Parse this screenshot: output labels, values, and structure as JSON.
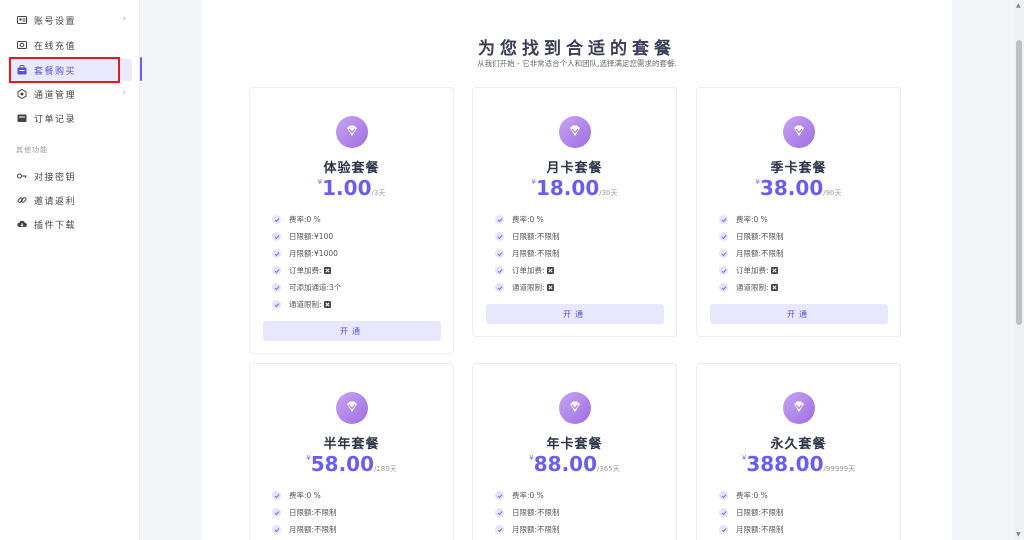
{
  "sidebar": {
    "items": [
      {
        "label": "账号设置",
        "icon": "id-card-icon",
        "has_arrow": true
      },
      {
        "label": "在线充值",
        "icon": "wallet-icon",
        "has_arrow": false
      },
      {
        "label": "套餐购买",
        "icon": "shopping-bag-icon",
        "has_arrow": false,
        "active": true
      },
      {
        "label": "通道管理",
        "icon": "settings-hex-icon",
        "has_arrow": true
      },
      {
        "label": "订单记录",
        "icon": "order-folder-icon",
        "has_arrow": false
      }
    ],
    "section_label": "其他功能",
    "extra_items": [
      {
        "label": "对接密钥",
        "icon": "key-icon"
      },
      {
        "label": "邀请返利",
        "icon": "link-icon"
      },
      {
        "label": "插件下载",
        "icon": "cloud-download-icon"
      }
    ],
    "arrow_glyph": "›"
  },
  "main": {
    "title": "为您找到合适的套餐",
    "subtitle": "从我们开始 - 它非常适合个人和团队,选择满足您需求的套餐."
  },
  "plans": [
    {
      "name": "体验套餐",
      "currency": "¥",
      "price": "1.00",
      "period": "/3天",
      "features": [
        {
          "label": "费率:",
          "value": "0 %"
        },
        {
          "label": "日限额:",
          "value": "¥100"
        },
        {
          "label": "月限额:",
          "value": "¥1000"
        },
        {
          "label": "订单加费:",
          "value": "",
          "x": true
        },
        {
          "label": "可添加通道:",
          "value": "3个"
        },
        {
          "label": "通道限制:",
          "value": "",
          "x": true
        }
      ],
      "button": "开通"
    },
    {
      "name": "月卡套餐",
      "currency": "¥",
      "price": "18.00",
      "period": "/30天",
      "features": [
        {
          "label": "费率:",
          "value": "0 %"
        },
        {
          "label": "日限额:",
          "value": "不限制"
        },
        {
          "label": "月限额:",
          "value": "不限制"
        },
        {
          "label": "订单加费:",
          "value": "",
          "x": true
        },
        {
          "label": "通道限制:",
          "value": "",
          "x": true
        }
      ],
      "button": "开通"
    },
    {
      "name": "季卡套餐",
      "currency": "¥",
      "price": "38.00",
      "period": "/90天",
      "features": [
        {
          "label": "费率:",
          "value": "0 %"
        },
        {
          "label": "日限额:",
          "value": "不限制"
        },
        {
          "label": "月限额:",
          "value": "不限制"
        },
        {
          "label": "订单加费:",
          "value": "",
          "x": true
        },
        {
          "label": "通道限制:",
          "value": "",
          "x": true
        }
      ],
      "button": "开通"
    },
    {
      "name": "半年套餐",
      "currency": "¥",
      "price": "58.00",
      "period": "/180天",
      "features": [
        {
          "label": "费率:",
          "value": "0 %"
        },
        {
          "label": "日限额:",
          "value": "不限制"
        },
        {
          "label": "月限额:",
          "value": "不限制"
        }
      ],
      "button": ""
    },
    {
      "name": "年卡套餐",
      "currency": "¥",
      "price": "88.00",
      "period": "/365天",
      "features": [
        {
          "label": "费率:",
          "value": "0 %"
        },
        {
          "label": "日限额:",
          "value": "不限制"
        },
        {
          "label": "月限额:",
          "value": "不限制"
        }
      ],
      "button": ""
    },
    {
      "name": "永久套餐",
      "currency": "¥",
      "price": "388.00",
      "period": "/99999天",
      "features": [
        {
          "label": "费率:",
          "value": "0 %"
        },
        {
          "label": "日限额:",
          "value": "不限制"
        },
        {
          "label": "月限额:",
          "value": "不限制"
        }
      ],
      "button": ""
    }
  ],
  "colors": {
    "accent": "#6a5ef0",
    "active_bg": "#ebe9fd",
    "highlight": "#e21c1c"
  }
}
